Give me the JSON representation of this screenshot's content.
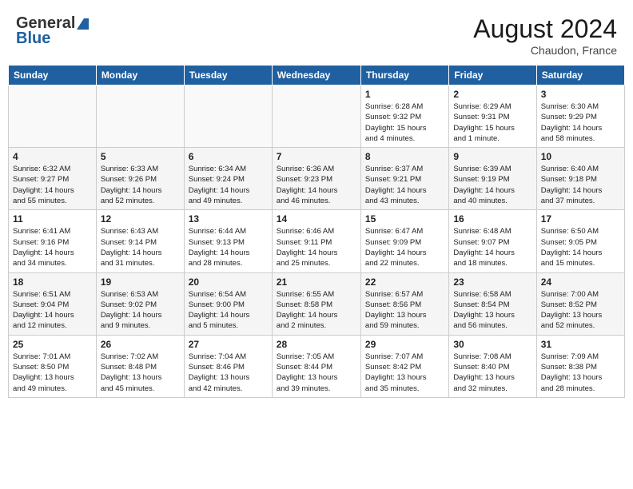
{
  "header": {
    "logo_general": "General",
    "logo_blue": "Blue",
    "month_year": "August 2024",
    "location": "Chaudon, France"
  },
  "days_of_week": [
    "Sunday",
    "Monday",
    "Tuesday",
    "Wednesday",
    "Thursday",
    "Friday",
    "Saturday"
  ],
  "weeks": [
    [
      {
        "day": "",
        "info": ""
      },
      {
        "day": "",
        "info": ""
      },
      {
        "day": "",
        "info": ""
      },
      {
        "day": "",
        "info": ""
      },
      {
        "day": "1",
        "info": "Sunrise: 6:28 AM\nSunset: 9:32 PM\nDaylight: 15 hours\nand 4 minutes."
      },
      {
        "day": "2",
        "info": "Sunrise: 6:29 AM\nSunset: 9:31 PM\nDaylight: 15 hours\nand 1 minute."
      },
      {
        "day": "3",
        "info": "Sunrise: 6:30 AM\nSunset: 9:29 PM\nDaylight: 14 hours\nand 58 minutes."
      }
    ],
    [
      {
        "day": "4",
        "info": "Sunrise: 6:32 AM\nSunset: 9:27 PM\nDaylight: 14 hours\nand 55 minutes."
      },
      {
        "day": "5",
        "info": "Sunrise: 6:33 AM\nSunset: 9:26 PM\nDaylight: 14 hours\nand 52 minutes."
      },
      {
        "day": "6",
        "info": "Sunrise: 6:34 AM\nSunset: 9:24 PM\nDaylight: 14 hours\nand 49 minutes."
      },
      {
        "day": "7",
        "info": "Sunrise: 6:36 AM\nSunset: 9:23 PM\nDaylight: 14 hours\nand 46 minutes."
      },
      {
        "day": "8",
        "info": "Sunrise: 6:37 AM\nSunset: 9:21 PM\nDaylight: 14 hours\nand 43 minutes."
      },
      {
        "day": "9",
        "info": "Sunrise: 6:39 AM\nSunset: 9:19 PM\nDaylight: 14 hours\nand 40 minutes."
      },
      {
        "day": "10",
        "info": "Sunrise: 6:40 AM\nSunset: 9:18 PM\nDaylight: 14 hours\nand 37 minutes."
      }
    ],
    [
      {
        "day": "11",
        "info": "Sunrise: 6:41 AM\nSunset: 9:16 PM\nDaylight: 14 hours\nand 34 minutes."
      },
      {
        "day": "12",
        "info": "Sunrise: 6:43 AM\nSunset: 9:14 PM\nDaylight: 14 hours\nand 31 minutes."
      },
      {
        "day": "13",
        "info": "Sunrise: 6:44 AM\nSunset: 9:13 PM\nDaylight: 14 hours\nand 28 minutes."
      },
      {
        "day": "14",
        "info": "Sunrise: 6:46 AM\nSunset: 9:11 PM\nDaylight: 14 hours\nand 25 minutes."
      },
      {
        "day": "15",
        "info": "Sunrise: 6:47 AM\nSunset: 9:09 PM\nDaylight: 14 hours\nand 22 minutes."
      },
      {
        "day": "16",
        "info": "Sunrise: 6:48 AM\nSunset: 9:07 PM\nDaylight: 14 hours\nand 18 minutes."
      },
      {
        "day": "17",
        "info": "Sunrise: 6:50 AM\nSunset: 9:05 PM\nDaylight: 14 hours\nand 15 minutes."
      }
    ],
    [
      {
        "day": "18",
        "info": "Sunrise: 6:51 AM\nSunset: 9:04 PM\nDaylight: 14 hours\nand 12 minutes."
      },
      {
        "day": "19",
        "info": "Sunrise: 6:53 AM\nSunset: 9:02 PM\nDaylight: 14 hours\nand 9 minutes."
      },
      {
        "day": "20",
        "info": "Sunrise: 6:54 AM\nSunset: 9:00 PM\nDaylight: 14 hours\nand 5 minutes."
      },
      {
        "day": "21",
        "info": "Sunrise: 6:55 AM\nSunset: 8:58 PM\nDaylight: 14 hours\nand 2 minutes."
      },
      {
        "day": "22",
        "info": "Sunrise: 6:57 AM\nSunset: 8:56 PM\nDaylight: 13 hours\nand 59 minutes."
      },
      {
        "day": "23",
        "info": "Sunrise: 6:58 AM\nSunset: 8:54 PM\nDaylight: 13 hours\nand 56 minutes."
      },
      {
        "day": "24",
        "info": "Sunrise: 7:00 AM\nSunset: 8:52 PM\nDaylight: 13 hours\nand 52 minutes."
      }
    ],
    [
      {
        "day": "25",
        "info": "Sunrise: 7:01 AM\nSunset: 8:50 PM\nDaylight: 13 hours\nand 49 minutes."
      },
      {
        "day": "26",
        "info": "Sunrise: 7:02 AM\nSunset: 8:48 PM\nDaylight: 13 hours\nand 45 minutes."
      },
      {
        "day": "27",
        "info": "Sunrise: 7:04 AM\nSunset: 8:46 PM\nDaylight: 13 hours\nand 42 minutes."
      },
      {
        "day": "28",
        "info": "Sunrise: 7:05 AM\nSunset: 8:44 PM\nDaylight: 13 hours\nand 39 minutes."
      },
      {
        "day": "29",
        "info": "Sunrise: 7:07 AM\nSunset: 8:42 PM\nDaylight: 13 hours\nand 35 minutes."
      },
      {
        "day": "30",
        "info": "Sunrise: 7:08 AM\nSunset: 8:40 PM\nDaylight: 13 hours\nand 32 minutes."
      },
      {
        "day": "31",
        "info": "Sunrise: 7:09 AM\nSunset: 8:38 PM\nDaylight: 13 hours\nand 28 minutes."
      }
    ]
  ]
}
